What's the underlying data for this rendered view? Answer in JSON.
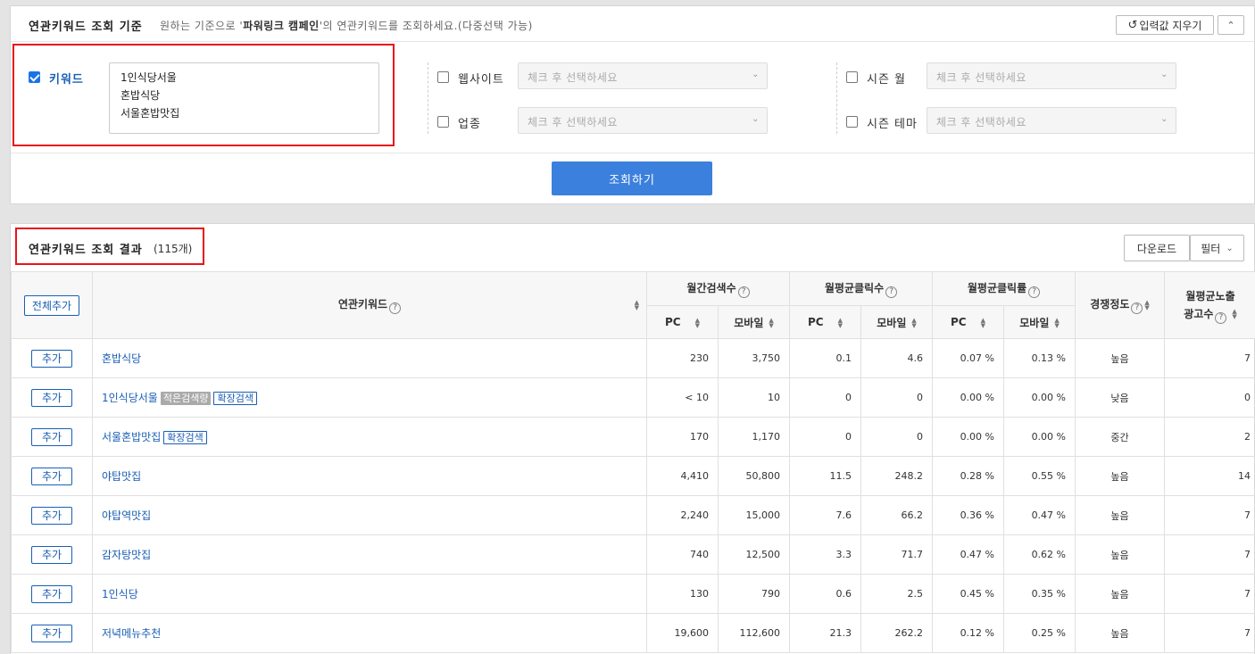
{
  "criteria": {
    "title": "연관키워드 조회 기준",
    "desc_prefix": "원하는 기준으로 '",
    "desc_campaign": "파워링크 캠페인",
    "desc_suffix": "'의 연관키워드를 조회하세요.(다중선택 가능)",
    "reset_label": "입력값 지우기",
    "collapse_icon": "⌃",
    "keyword_label": "키워드",
    "keywords": [
      "1인식당서울",
      "혼밥식당",
      "서울혼밥맛집"
    ],
    "options": [
      {
        "label": "웹사이트",
        "placeholder": "체크 후 선택하세요"
      },
      {
        "label": "업종",
        "placeholder": "체크 후 선택하세요"
      },
      {
        "label": "시즌 월",
        "placeholder": "체크 후 선택하세요"
      },
      {
        "label": "시즌 테마",
        "placeholder": "체크 후 선택하세요"
      }
    ],
    "search_label": "조회하기"
  },
  "results": {
    "title": "연관키워드 조회 결과",
    "count": "(115개)",
    "download_label": "다운로드",
    "filter_label": "필터",
    "headers": {
      "add_all": "전체추가",
      "keyword": "연관키워드",
      "monthly_search": "월간검색수",
      "avg_clicks": "월평균클릭수",
      "avg_ctr": "월평균클릭률",
      "competition": "경쟁정도",
      "avg_ads_line1": "월평균노출",
      "avg_ads_line2": "광고수",
      "pc": "PC",
      "mobile": "모바일"
    },
    "add_label": "추가",
    "rows": [
      {
        "keyword": "혼밥식당",
        "tags": [],
        "pc": "230",
        "mobile": "3,750",
        "click_pc": "0.1",
        "click_mobile": "4.6",
        "ctr_pc": "0.07 %",
        "ctr_mobile": "0.13 %",
        "competition": "높음",
        "ads": "7"
      },
      {
        "keyword": "1인식당서울",
        "tags": [
          {
            "type": "gray",
            "text": "적은검색량"
          },
          {
            "type": "blue",
            "text": "확장검색"
          }
        ],
        "pc": "< 10",
        "mobile": "10",
        "click_pc": "0",
        "click_mobile": "0",
        "ctr_pc": "0.00 %",
        "ctr_mobile": "0.00 %",
        "competition": "낮음",
        "ads": "0"
      },
      {
        "keyword": "서울혼밥맛집",
        "tags": [
          {
            "type": "blue",
            "text": "확장검색"
          }
        ],
        "pc": "170",
        "mobile": "1,170",
        "click_pc": "0",
        "click_mobile": "0",
        "ctr_pc": "0.00 %",
        "ctr_mobile": "0.00 %",
        "competition": "중간",
        "ads": "2"
      },
      {
        "keyword": "야탑맛집",
        "tags": [],
        "pc": "4,410",
        "mobile": "50,800",
        "click_pc": "11.5",
        "click_mobile": "248.2",
        "ctr_pc": "0.28 %",
        "ctr_mobile": "0.55 %",
        "competition": "높음",
        "ads": "14"
      },
      {
        "keyword": "야탑역맛집",
        "tags": [],
        "pc": "2,240",
        "mobile": "15,000",
        "click_pc": "7.6",
        "click_mobile": "66.2",
        "ctr_pc": "0.36 %",
        "ctr_mobile": "0.47 %",
        "competition": "높음",
        "ads": "7"
      },
      {
        "keyword": "감자탕맛집",
        "tags": [],
        "pc": "740",
        "mobile": "12,500",
        "click_pc": "3.3",
        "click_mobile": "71.7",
        "ctr_pc": "0.47 %",
        "ctr_mobile": "0.62 %",
        "competition": "높음",
        "ads": "7"
      },
      {
        "keyword": "1인식당",
        "tags": [],
        "pc": "130",
        "mobile": "790",
        "click_pc": "0.6",
        "click_mobile": "2.5",
        "ctr_pc": "0.45 %",
        "ctr_mobile": "0.35 %",
        "competition": "높음",
        "ads": "7"
      },
      {
        "keyword": "저녁메뉴추천",
        "tags": [],
        "pc": "19,600",
        "mobile": "112,600",
        "click_pc": "21.3",
        "click_mobile": "262.2",
        "ctr_pc": "0.12 %",
        "ctr_mobile": "0.25 %",
        "competition": "높음",
        "ads": "7"
      }
    ]
  }
}
